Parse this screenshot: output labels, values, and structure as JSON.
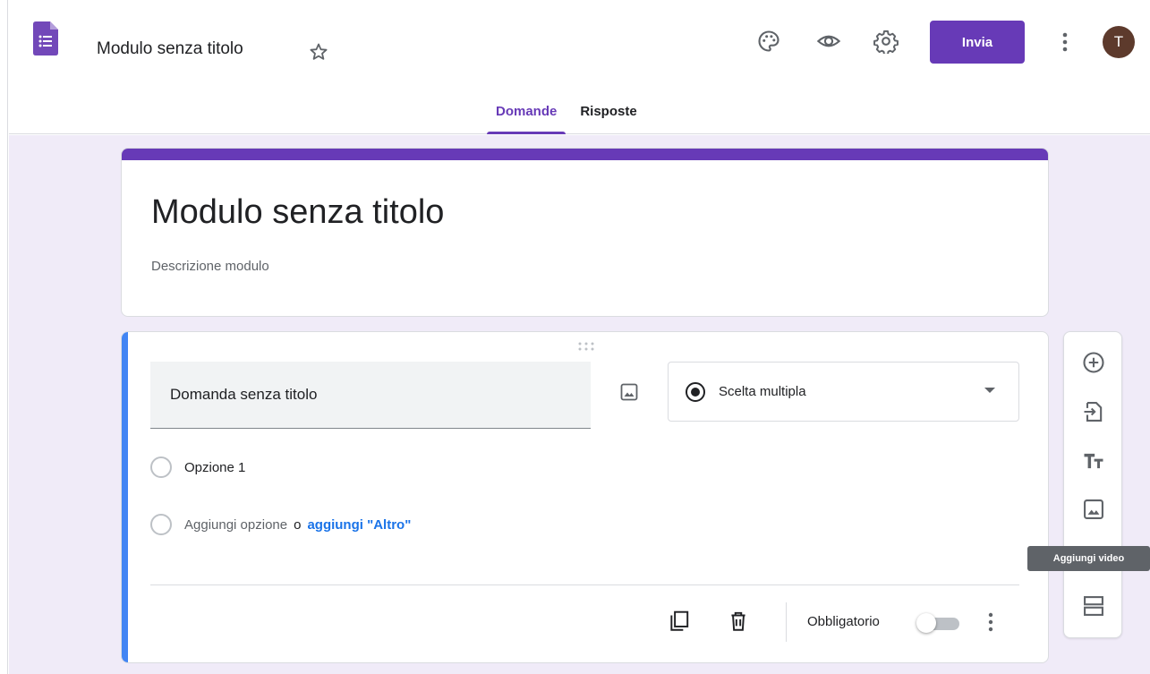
{
  "header": {
    "title": "Modulo senza titolo",
    "send_label": "Invia",
    "avatar_letter": "T"
  },
  "tabs": [
    {
      "label": "Domande",
      "active": true
    },
    {
      "label": "Risposte",
      "active": false
    }
  ],
  "form": {
    "title": "Modulo senza titolo",
    "description": "Descrizione modulo"
  },
  "question": {
    "title": "Domanda senza titolo",
    "type": "Scelta multipla",
    "options": [
      "Opzione 1"
    ],
    "add_option": "Aggiungi opzione",
    "or": "o",
    "add_other": "aggiungi \"Altro\"",
    "required_label": "Obbligatorio",
    "required": false
  },
  "toolbar": {
    "tooltip": "Aggiungi video",
    "icons": [
      "add-question-icon",
      "import-questions-icon",
      "add-title-icon",
      "add-image-icon",
      "add-video-icon",
      "add-section-icon"
    ]
  },
  "colors": {
    "brand": "#673ab7",
    "accent": "#4285f4",
    "background": "#f0ebf8",
    "link": "#1a73e8"
  }
}
